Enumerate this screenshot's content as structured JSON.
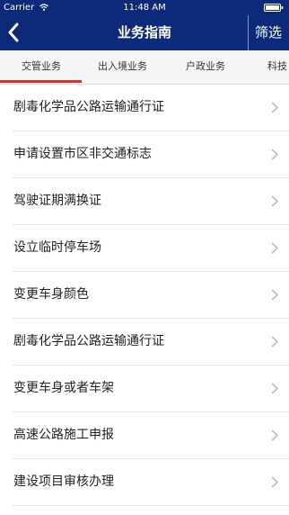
{
  "status_bar": {
    "carrier": "Carrier",
    "time": "11:48 AM"
  },
  "nav": {
    "title": "业务指南",
    "filter_label": "筛选",
    "back_icon": "back-chevron-icon"
  },
  "tabs": [
    {
      "label": "交管业务",
      "selected": true
    },
    {
      "label": "出入境业务",
      "selected": false
    },
    {
      "label": "户政业务",
      "selected": false
    },
    {
      "label": "科技",
      "selected": false
    }
  ],
  "items": [
    {
      "label": "剧毒化学品公路运输通行证"
    },
    {
      "label": "申请设置市区非交通标志"
    },
    {
      "label": "驾驶证期满换证"
    },
    {
      "label": "设立临时停车场"
    },
    {
      "label": "变更车身颜色"
    },
    {
      "label": "剧毒化学品公路运输通行证"
    },
    {
      "label": "变更车身或者车架"
    },
    {
      "label": "高速公路施工申报"
    },
    {
      "label": "建设项目审核办理"
    }
  ],
  "colors": {
    "nav_background": "#0d2a7a",
    "tab_indicator": "#d9342b"
  }
}
